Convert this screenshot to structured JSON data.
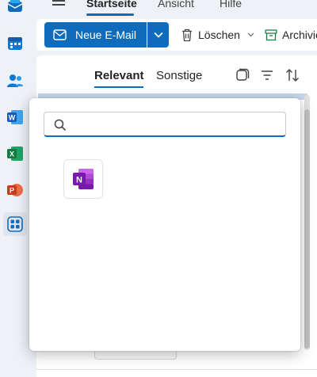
{
  "header": {
    "tabs": [
      {
        "label": "Startseite",
        "active": true
      },
      {
        "label": "Ansicht",
        "active": false
      },
      {
        "label": "Hilfe",
        "active": false
      }
    ]
  },
  "rail": {
    "items": [
      {
        "icon": "outlook-mail-icon"
      },
      {
        "icon": "calendar-icon"
      },
      {
        "icon": "people-icon"
      },
      {
        "icon": "word-icon"
      },
      {
        "icon": "excel-icon"
      },
      {
        "icon": "powerpoint-icon"
      },
      {
        "icon": "more-apps-icon",
        "active": true
      }
    ]
  },
  "ribbon": {
    "new_mail_label": "Neue E-Mail",
    "delete_label": "Löschen",
    "archive_label": "Archivie"
  },
  "list": {
    "tabs": [
      {
        "label": "Relevant",
        "active": true
      },
      {
        "label": "Sonstige",
        "active": false
      }
    ]
  },
  "launcher": {
    "search": {
      "value": "",
      "placeholder": ""
    },
    "apps": [
      {
        "name": "OneNote",
        "icon": "onenote-icon",
        "letter": "N"
      }
    ]
  },
  "colors": {
    "accent": "#0f6cbd",
    "onenote": "#7719aa",
    "word": "#185abd",
    "excel": "#107c41",
    "powerpoint": "#c43e1c"
  }
}
